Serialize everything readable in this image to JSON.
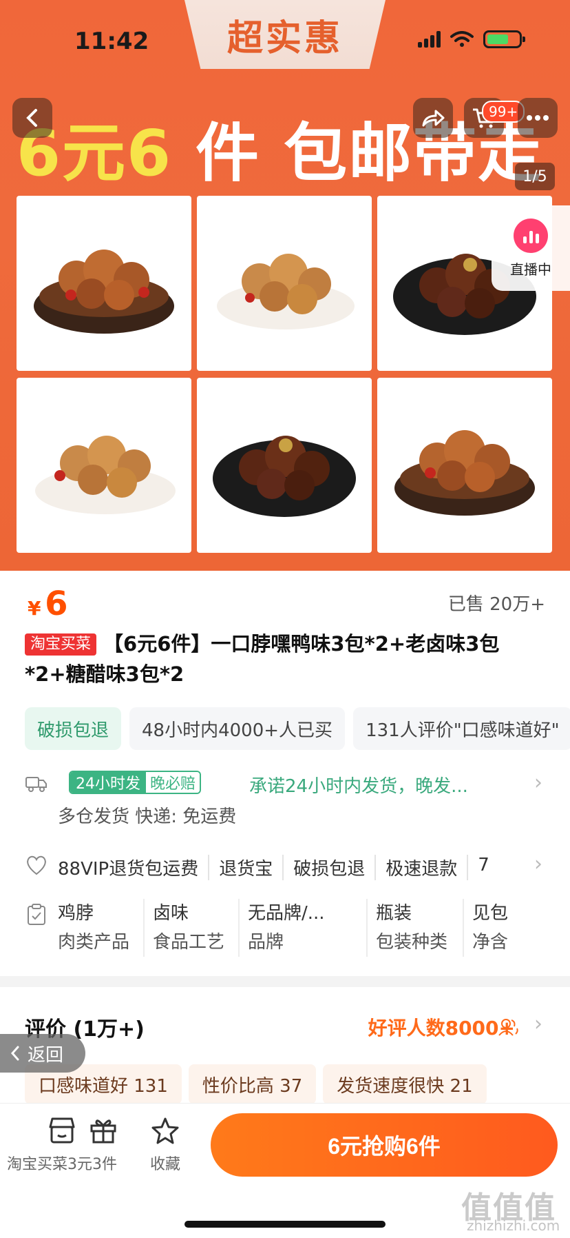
{
  "status": {
    "time": "11:42"
  },
  "banner": {
    "tab": "超实惠",
    "headline_a": "6元6",
    "headline_b": " 件 包邮带走"
  },
  "nav": {
    "cart_badge": "99+",
    "pager": "1/5",
    "live_label": "直播中"
  },
  "product": {
    "price_currency": "¥",
    "price": "6",
    "sold": "已售 20万+",
    "store_tag": "淘宝买菜",
    "title": "【6元6件】一口脖嘿鸭味3包*2+老卤味3包*2+糖醋味3包*2",
    "chips": [
      "破损包退",
      "48小时内4000+人已买",
      "131人评价\"口感味道好\""
    ]
  },
  "shipping": {
    "badge_a": "24小时发",
    "badge_b": "晚必赔",
    "promise": "承诺24小时内发货，晚发...",
    "sub": "多仓发货  快递: 免运费"
  },
  "services": [
    "88VIP退货包运费",
    "退货宝",
    "破损包退",
    "极速退款",
    "7"
  ],
  "attributes": [
    {
      "value": "鸡脖",
      "key": "肉类产品"
    },
    {
      "value": "卤味",
      "key": "食品工艺"
    },
    {
      "value": "无品牌/...",
      "key": "品牌"
    },
    {
      "value": "瓶装",
      "key": "包装种类"
    },
    {
      "value": "见包",
      "key": "净含"
    }
  ],
  "review": {
    "title": "评价 (1万+)",
    "good_count": "好评人数8000+",
    "tags": [
      "口感味道好 131",
      "性价比高 37",
      "发货速度很快 21"
    ],
    "back": "返回"
  },
  "bottom": {
    "store": "淘宝买菜3元3件",
    "gift": "",
    "favorite": "收藏",
    "buy": "6元抢购6件"
  },
  "watermark": {
    "main": "值值值",
    "sub": "zhizhizhi.com"
  },
  "colors": {
    "accent": "#ff5000",
    "hero": "#ef6a3c",
    "green": "#3cb483"
  }
}
